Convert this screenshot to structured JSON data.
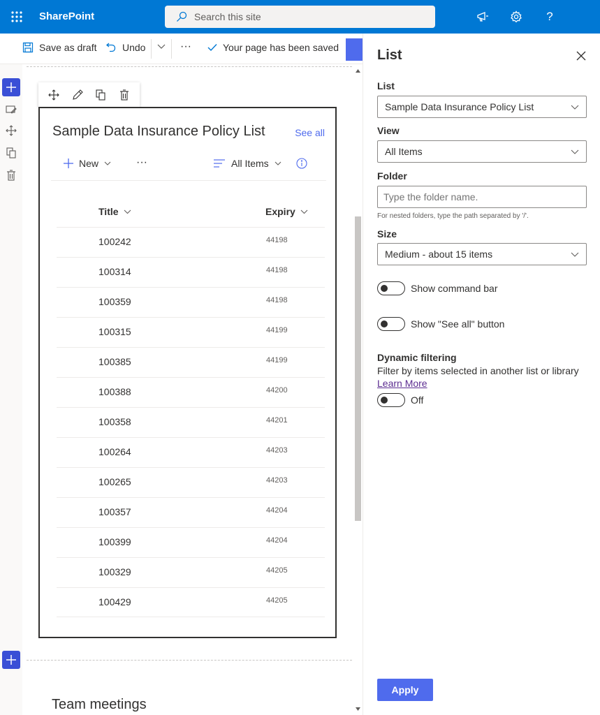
{
  "suite": {
    "app_name": "SharePoint",
    "search_placeholder": "Search this site"
  },
  "command_bar": {
    "save_draft": "Save as draft",
    "undo": "Undo",
    "more": "···",
    "status": "Your page has been saved"
  },
  "webpart": {
    "title": "Sample Data Insurance Policy List",
    "see_all": "See all",
    "new_label": "New",
    "more": "···",
    "view_label": "All Items",
    "columns": {
      "title": "Title",
      "expiry": "Expiry"
    },
    "rows": [
      {
        "title": "100242",
        "expiry": "44198"
      },
      {
        "title": "100314",
        "expiry": "44198"
      },
      {
        "title": "100359",
        "expiry": "44198"
      },
      {
        "title": "100315",
        "expiry": "44199"
      },
      {
        "title": "100385",
        "expiry": "44199"
      },
      {
        "title": "100388",
        "expiry": "44200"
      },
      {
        "title": "100358",
        "expiry": "44201"
      },
      {
        "title": "100264",
        "expiry": "44203"
      },
      {
        "title": "100265",
        "expiry": "44203"
      },
      {
        "title": "100357",
        "expiry": "44204"
      },
      {
        "title": "100399",
        "expiry": "44204"
      },
      {
        "title": "100329",
        "expiry": "44205"
      },
      {
        "title": "100429",
        "expiry": "44205"
      }
    ]
  },
  "next_section": {
    "title": "Team meetings"
  },
  "pane": {
    "title": "List",
    "list_label": "List",
    "list_value": "Sample Data Insurance Policy List",
    "view_label": "View",
    "view_value": "All Items",
    "folder_label": "Folder",
    "folder_placeholder": "Type the folder name.",
    "folder_hint": "For nested folders, type the path separated by '/'.",
    "size_label": "Size",
    "size_value": "Medium - about 15 items",
    "show_command_bar": "Show command bar",
    "show_see_all": "Show \"See all\" button",
    "dynamic_filtering_label": "Dynamic filtering",
    "dynamic_filtering_desc": "Filter by items selected in another list or library",
    "learn_more": "Learn More",
    "dynamic_toggle_state": "Off",
    "apply": "Apply"
  },
  "colors": {
    "suite_blue": "#0078d4",
    "accent": "#4f6bed",
    "rail_add": "#3a4fd6"
  }
}
